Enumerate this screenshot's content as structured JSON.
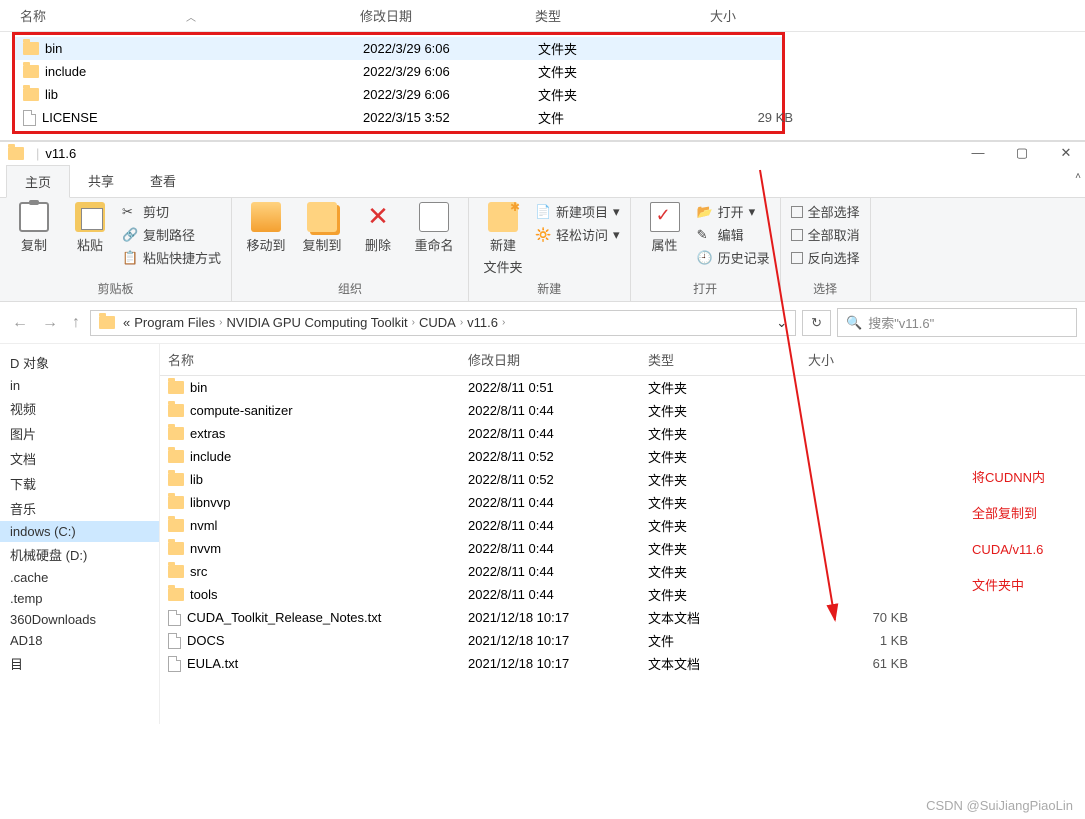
{
  "cols": {
    "name": "名称",
    "date": "修改日期",
    "type": "类型",
    "size": "大小"
  },
  "top_rows": [
    {
      "icon": "folder",
      "name": "bin",
      "date": "2022/3/29 6:06",
      "type": "文件夹",
      "size": "",
      "sel": true
    },
    {
      "icon": "folder",
      "name": "include",
      "date": "2022/3/29 6:06",
      "type": "文件夹",
      "size": ""
    },
    {
      "icon": "folder",
      "name": "lib",
      "date": "2022/3/29 6:06",
      "type": "文件夹",
      "size": ""
    },
    {
      "icon": "file",
      "name": "LICENSE",
      "date": "2022/3/15 3:52",
      "type": "文件",
      "size": "29 KB"
    }
  ],
  "win2_title": "v11.6",
  "tabs": {
    "main": "主页",
    "share": "共享",
    "view": "查看"
  },
  "ribbon": {
    "clipboard": {
      "copy": "复制",
      "paste": "粘贴",
      "cut": "剪切",
      "copypath": "复制路径",
      "pasteshortcut": "粘贴快捷方式",
      "label": "剪贴板"
    },
    "organize": {
      "moveto": "移动到",
      "copyto": "复制到",
      "delete": "删除",
      "rename": "重命名",
      "label": "组织"
    },
    "new": {
      "newfolder_l1": "新建",
      "newfolder_l2": "文件夹",
      "newitem": "新建项目",
      "easyaccess": "轻松访问",
      "label": "新建"
    },
    "open": {
      "props": "属性",
      "open": "打开",
      "edit": "编辑",
      "history": "历史记录",
      "label": "打开"
    },
    "select": {
      "all": "全部选择",
      "none": "全部取消",
      "invert": "反向选择",
      "label": "选择"
    }
  },
  "breadcrumb": [
    "Program Files",
    "NVIDIA GPU Computing Toolkit",
    "CUDA",
    "v11.6"
  ],
  "breadcrumb_prefix": "«",
  "search_placeholder": "搜索\"v11.6\"",
  "sidebar": [
    "D 对象",
    "in",
    "视频",
    "图片",
    "文档",
    "下载",
    "音乐",
    {
      "label": "indows (C:)",
      "sel": true
    },
    "机械硬盘 (D:)",
    ".cache",
    ".temp",
    "360Downloads",
    "AD18",
    "目"
  ],
  "rows2": [
    {
      "icon": "folder",
      "name": "bin",
      "date": "2022/8/11 0:51",
      "type": "文件夹",
      "size": ""
    },
    {
      "icon": "folder",
      "name": "compute-sanitizer",
      "date": "2022/8/11 0:44",
      "type": "文件夹",
      "size": ""
    },
    {
      "icon": "folder",
      "name": "extras",
      "date": "2022/8/11 0:44",
      "type": "文件夹",
      "size": ""
    },
    {
      "icon": "folder",
      "name": "include",
      "date": "2022/8/11 0:52",
      "type": "文件夹",
      "size": ""
    },
    {
      "icon": "folder",
      "name": "lib",
      "date": "2022/8/11 0:52",
      "type": "文件夹",
      "size": ""
    },
    {
      "icon": "folder",
      "name": "libnvvp",
      "date": "2022/8/11 0:44",
      "type": "文件夹",
      "size": ""
    },
    {
      "icon": "folder",
      "name": "nvml",
      "date": "2022/8/11 0:44",
      "type": "文件夹",
      "size": ""
    },
    {
      "icon": "folder",
      "name": "nvvm",
      "date": "2022/8/11 0:44",
      "type": "文件夹",
      "size": ""
    },
    {
      "icon": "folder",
      "name": "src",
      "date": "2022/8/11 0:44",
      "type": "文件夹",
      "size": ""
    },
    {
      "icon": "folder",
      "name": "tools",
      "date": "2022/8/11 0:44",
      "type": "文件夹",
      "size": ""
    },
    {
      "icon": "file",
      "name": "CUDA_Toolkit_Release_Notes.txt",
      "date": "2021/12/18 10:17",
      "type": "文本文档",
      "size": "70 KB"
    },
    {
      "icon": "file",
      "name": "DOCS",
      "date": "2021/12/18 10:17",
      "type": "文件",
      "size": "1 KB"
    },
    {
      "icon": "file",
      "name": "EULA.txt",
      "date": "2021/12/18 10:17",
      "type": "文本文档",
      "size": "61 KB"
    }
  ],
  "annotation": [
    "将CUDNN内",
    "全部复制到",
    "CUDA/v11.6",
    "文件夹中"
  ],
  "watermark": "CSDN @SuiJiangPiaoLin"
}
